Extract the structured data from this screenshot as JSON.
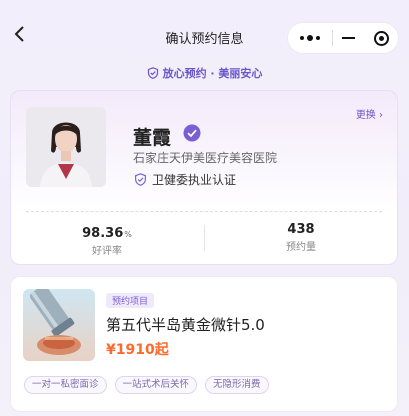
{
  "header": {
    "title": "确认预约信息",
    "back_icon": "chevron-left-icon",
    "capsule": {
      "more_icon": "more-dots-icon",
      "minimize_icon": "minimize-icon",
      "close_icon": "target-close-icon"
    }
  },
  "slogan": {
    "icon": "shield-check-icon",
    "text": "放心预约 · 美丽安心"
  },
  "doctor": {
    "name": "董霞",
    "verified_icon": "verified-check-icon",
    "hospital": "石家庄天伊美医疗美容医院",
    "cert_icon": "shield-check-icon",
    "certification": "卫健委执业认证",
    "change_label": "更换 ›",
    "stats": {
      "rating_value": "98.36",
      "rating_unit": "%",
      "rating_label": "好评率",
      "bookings_value": "438",
      "bookings_label": "预约量"
    }
  },
  "project": {
    "tag": "预约项目",
    "name": "第五代半岛黄金微针5.0",
    "price": "¥1910起",
    "chips": [
      "一对一私密面诊",
      "一站式术后关怀",
      "无隐形消费"
    ]
  },
  "colors": {
    "accent": "#6b55c9",
    "price": "#ff6a2c",
    "background": "#f3eefb"
  }
}
